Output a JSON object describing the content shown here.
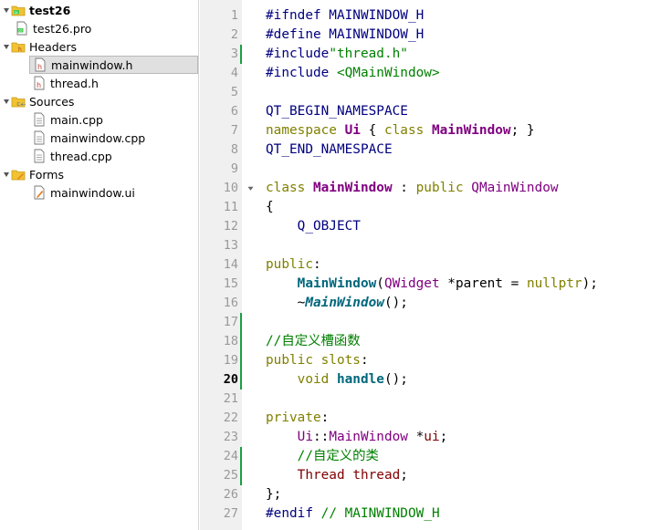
{
  "project_tree": {
    "project": {
      "name": "test26",
      "pro_file": "test26.pro"
    },
    "groups": [
      {
        "label": "Headers",
        "files": [
          "mainwindow.h",
          "thread.h"
        ]
      },
      {
        "label": "Sources",
        "files": [
          "main.cpp",
          "mainwindow.cpp",
          "thread.cpp"
        ]
      },
      {
        "label": "Forms",
        "files": [
          "mainwindow.ui"
        ]
      }
    ],
    "selected_file": "mainwindow.h"
  },
  "editor": {
    "current_line": 20,
    "line_numbers": [
      "1",
      "2",
      "3",
      "4",
      "5",
      "6",
      "7",
      "8",
      "9",
      "10",
      "11",
      "12",
      "13",
      "14",
      "15",
      "16",
      "17",
      "18",
      "19",
      "20",
      "21",
      "22",
      "23",
      "24",
      "25",
      "26",
      "27"
    ],
    "lines": [
      [
        [
          "c-pre",
          "#ifndef MAINWINDOW_H"
        ]
      ],
      [
        [
          "c-pre",
          "#define MAINWINDOW_H"
        ]
      ],
      [
        [
          "c-pre",
          "#include"
        ],
        [
          "c-str",
          "\"thread.h\""
        ]
      ],
      [
        [
          "c-pre",
          "#include "
        ],
        [
          "c-str",
          "<QMainWindow>"
        ]
      ],
      [],
      [
        [
          "c-macro",
          "QT_BEGIN_NAMESPACE"
        ]
      ],
      [
        [
          "c-kw",
          "namespace "
        ],
        [
          "c-cls",
          "Ui"
        ],
        [
          "c-plain",
          " { "
        ],
        [
          "c-kw",
          "class "
        ],
        [
          "c-cls",
          "MainWindow"
        ],
        [
          "c-plain",
          "; }"
        ]
      ],
      [
        [
          "c-macro",
          "QT_END_NAMESPACE"
        ]
      ],
      [],
      [
        [
          "c-kw",
          "class "
        ],
        [
          "c-cls",
          "MainWindow"
        ],
        [
          "c-plain",
          " : "
        ],
        [
          "c-kw",
          "public "
        ],
        [
          "c-type",
          "QMainWindow"
        ]
      ],
      [
        [
          "c-plain",
          "{"
        ]
      ],
      [
        [
          "c-plain",
          "    "
        ],
        [
          "c-macro",
          "Q_OBJECT"
        ]
      ],
      [],
      [
        [
          "c-kw",
          "public"
        ],
        [
          "c-plain",
          ":"
        ]
      ],
      [
        [
          "c-plain",
          "    "
        ],
        [
          "c-fn",
          "MainWindow"
        ],
        [
          "c-plain",
          "("
        ],
        [
          "c-type",
          "QWidget"
        ],
        [
          "c-plain",
          " *parent = "
        ],
        [
          "c-kw",
          "nullptr"
        ],
        [
          "c-plain",
          ");"
        ]
      ],
      [
        [
          "c-plain",
          "    ~"
        ],
        [
          "c-fni",
          "MainWindow"
        ],
        [
          "c-plain",
          "();"
        ]
      ],
      [],
      [
        [
          "c-cm",
          "//自定义槽函数"
        ]
      ],
      [
        [
          "c-kw",
          "public slots"
        ],
        [
          "c-plain",
          ":"
        ]
      ],
      [
        [
          "c-plain",
          "    "
        ],
        [
          "c-kw",
          "void "
        ],
        [
          "c-fn",
          "handle"
        ],
        [
          "c-plain",
          "();"
        ]
      ],
      [],
      [
        [
          "c-kw",
          "private"
        ],
        [
          "c-plain",
          ":"
        ]
      ],
      [
        [
          "c-plain",
          "    "
        ],
        [
          "c-type",
          "Ui"
        ],
        [
          "c-plain",
          "::"
        ],
        [
          "c-type",
          "MainWindow"
        ],
        [
          "c-plain",
          " *"
        ],
        [
          "c-mem",
          "ui"
        ],
        [
          "c-plain",
          ";"
        ]
      ],
      [
        [
          "c-plain",
          "    "
        ],
        [
          "c-cm",
          "//自定义的类"
        ]
      ],
      [
        [
          "c-plain",
          "    "
        ],
        [
          "c-mem",
          "Thread"
        ],
        [
          "c-plain",
          " "
        ],
        [
          "c-mem",
          "thread"
        ],
        [
          "c-plain",
          ";"
        ]
      ],
      [
        [
          "c-plain",
          "};"
        ]
      ],
      [
        [
          "c-pre",
          "#endif "
        ],
        [
          "c-cm",
          "// MAINWINDOW_H"
        ]
      ]
    ],
    "changed_lines": [
      3,
      17,
      18,
      19,
      20,
      24,
      25
    ],
    "fold_lines": [
      10
    ]
  }
}
